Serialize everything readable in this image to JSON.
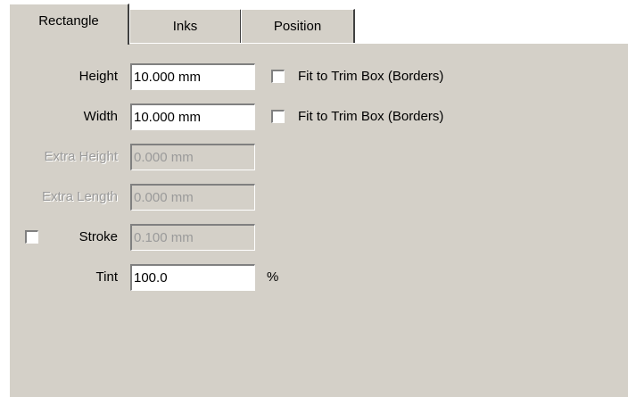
{
  "tabs": [
    {
      "label": "Rectangle",
      "active": true
    },
    {
      "label": "Inks",
      "active": false
    },
    {
      "label": "Position",
      "active": false
    }
  ],
  "form": {
    "height": {
      "label": "Height",
      "value": "10.000 mm",
      "enabled": true
    },
    "height_fit": {
      "label": "Fit to Trim Box (Borders)",
      "checked": false
    },
    "width": {
      "label": "Width",
      "value": "10.000 mm",
      "enabled": true
    },
    "width_fit": {
      "label": "Fit to Trim Box (Borders)",
      "checked": false
    },
    "extra_height": {
      "label": "Extra Height",
      "value": "0.000 mm",
      "enabled": false
    },
    "extra_length": {
      "label": "Extra Length",
      "value": "0.000 mm",
      "enabled": false
    },
    "stroke": {
      "label": "Stroke",
      "value": "0.100 mm",
      "checked": false,
      "enabled": false
    },
    "tint": {
      "label": "Tint",
      "value": "100.0",
      "unit": "%",
      "enabled": true
    }
  }
}
